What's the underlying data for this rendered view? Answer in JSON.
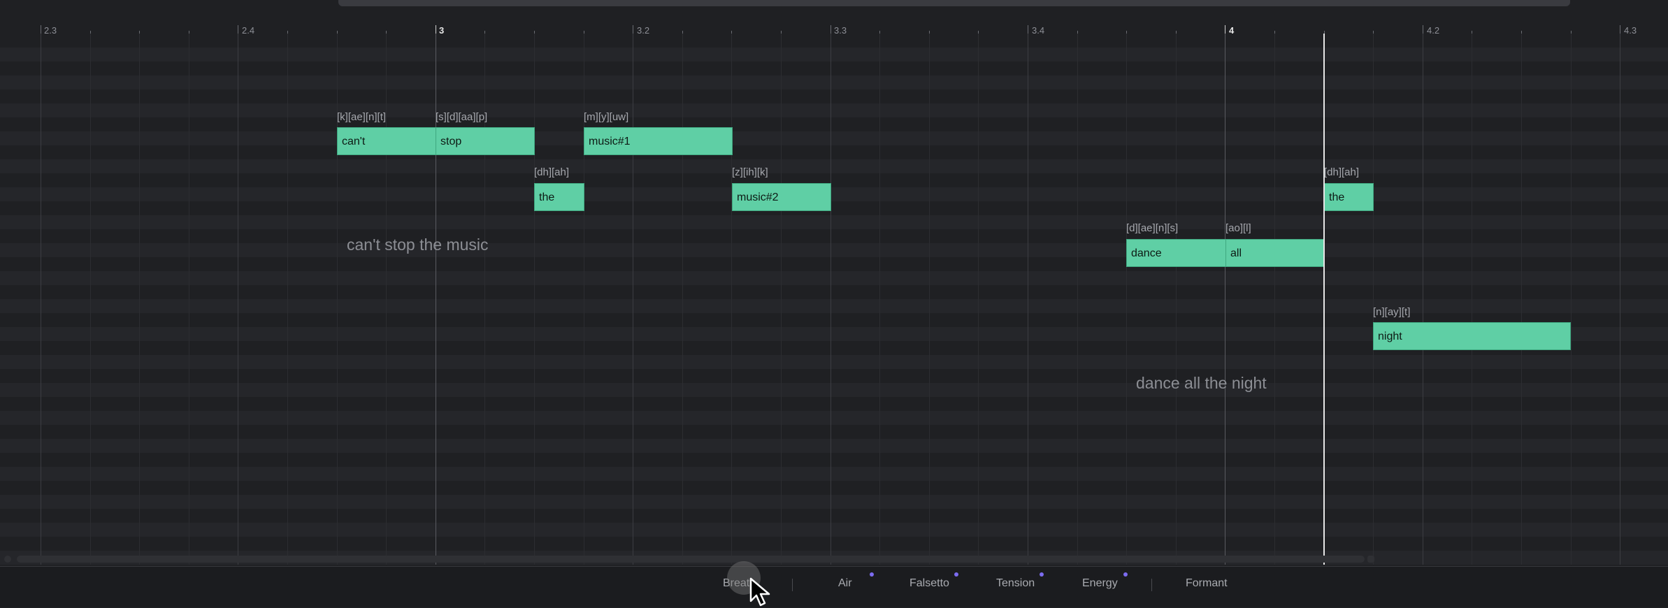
{
  "ruler": {
    "labels": [
      {
        "text": "2.3",
        "major": false
      },
      {
        "text": "2.4",
        "major": false
      },
      {
        "text": "3",
        "major": true
      },
      {
        "text": "3.2",
        "major": false
      },
      {
        "text": "3.3",
        "major": false
      },
      {
        "text": "3.4",
        "major": false
      },
      {
        "text": "4",
        "major": true
      },
      {
        "text": "4.2",
        "major": false
      },
      {
        "text": "4.3",
        "major": false
      }
    ]
  },
  "notes": [
    {
      "lyric": "can't",
      "phonemes": "[k][ae][n][t]"
    },
    {
      "lyric": "stop",
      "phonemes": "[s][d][aa][p]"
    },
    {
      "lyric": "music#1",
      "phonemes": "[m][y][uw]"
    },
    {
      "lyric": "the",
      "phonemes": "[dh][ah]"
    },
    {
      "lyric": "music#2",
      "phonemes": "[z][ih][k]"
    },
    {
      "lyric": "the",
      "phonemes": "[dh][ah]"
    },
    {
      "lyric": "dance",
      "phonemes": "[d][ae][n][s]"
    },
    {
      "lyric": "all",
      "phonemes": "[ao][l]"
    },
    {
      "lyric": "night",
      "phonemes": "[n][ay][t]"
    }
  ],
  "phrases": [
    "can't stop the music",
    "dance all the night"
  ],
  "params": {
    "tabs": [
      "Breath",
      "Air",
      "Falsetto",
      "Tension",
      "Energy",
      "Formant"
    ],
    "breath_visible": "Breat"
  },
  "colors": {
    "note_fill": "#5fcfa5",
    "param_dot": "#7c6cf0",
    "playhead": "#e6e6e6"
  }
}
